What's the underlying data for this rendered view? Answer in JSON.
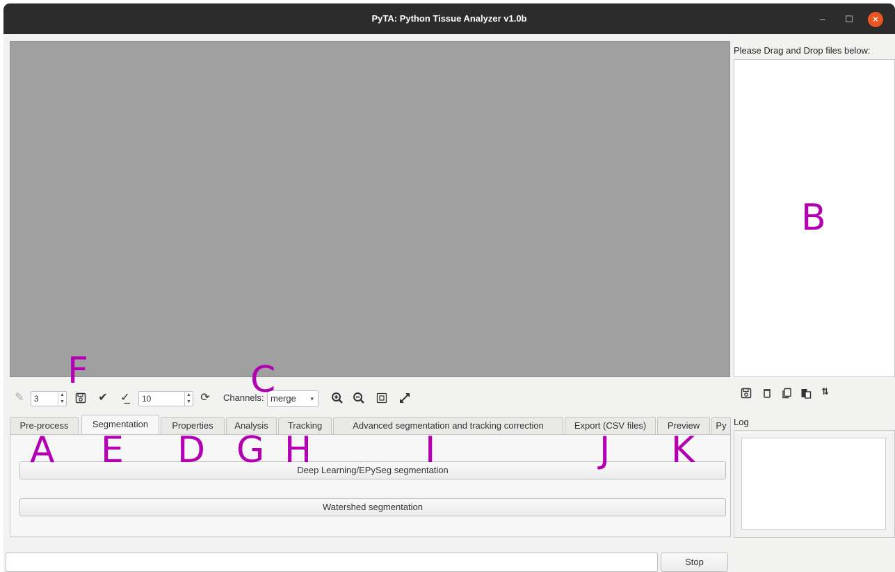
{
  "window": {
    "title": "PyTA: Python Tissue Analyzer v1.0b"
  },
  "window_controls": {
    "minimize": "–",
    "maximize": "☐",
    "close": "✕"
  },
  "drop_panel": {
    "label": "Please Drag and Drop files below:"
  },
  "toolbar": {
    "pen_size": "3",
    "threshold": "10",
    "channels_label": "Channels:",
    "channels_value": "merge"
  },
  "tabs": [
    {
      "label": "Pre-process"
    },
    {
      "label": "Segmentation"
    },
    {
      "label": "Properties"
    },
    {
      "label": "Analysis"
    },
    {
      "label": "Tracking"
    },
    {
      "label": "Advanced segmentation and tracking correction"
    },
    {
      "label": "Export (CSV files)"
    },
    {
      "label": "Preview"
    },
    {
      "label": "Py"
    }
  ],
  "active_tab": "Segmentation",
  "segmentation": {
    "deep_learning_button": "Deep Learning/EPySeg segmentation",
    "watershed_button": "Watershed segmentation"
  },
  "log": {
    "label": "Log"
  },
  "status": {
    "stop_button": "Stop"
  },
  "annotations": [
    "A",
    "B",
    "C",
    "D",
    "E",
    "F",
    "G",
    "H",
    "I",
    "J",
    "K"
  ],
  "colors": {
    "annotation": "#b200b2",
    "titlebar": "#2c2c2c",
    "close_button": "#e95420",
    "viewer": "#a0a0a0"
  }
}
